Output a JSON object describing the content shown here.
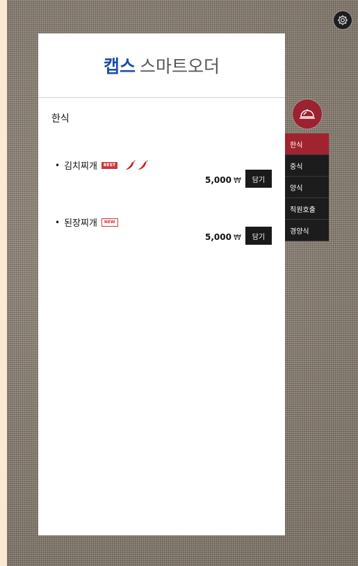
{
  "brand": {
    "strong": "캡스",
    "light": "스마트오더",
    "color": "#1f4fa3"
  },
  "category_title": "한식",
  "menu_items": [
    {
      "name": "김치찌개",
      "badge": "BEST",
      "spicy_level": 2,
      "price": "5,000",
      "currency": "₩",
      "add_label": "담기"
    },
    {
      "name": "된장찌개",
      "badge": "NEW",
      "price": "5,000",
      "currency": "₩",
      "add_label": "담기"
    }
  ],
  "side_nav": [
    {
      "label": "한식",
      "active": true
    },
    {
      "label": "중식",
      "active": false
    },
    {
      "label": "양식",
      "active": false
    },
    {
      "label": "직원호출",
      "active": false
    },
    {
      "label": "경양식",
      "active": false
    }
  ],
  "icons": {
    "settings": "gear-icon",
    "service": "cloche-icon",
    "spicy": "chili-pepper-icon"
  },
  "colors": {
    "accent": "#a0232f",
    "nav_bg": "#1c1c1c",
    "badge": "#c8393d"
  }
}
